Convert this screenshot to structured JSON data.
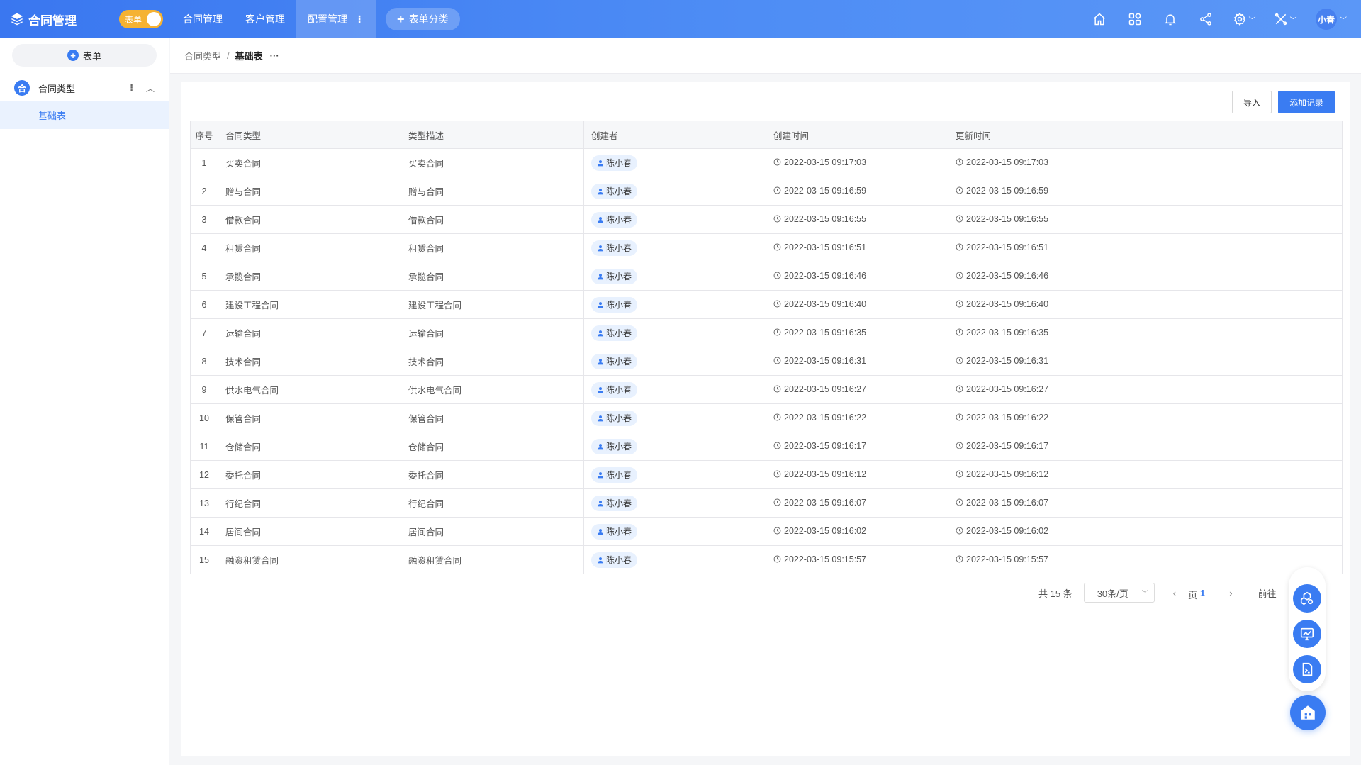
{
  "header": {
    "app_title": "合同管理",
    "toggle_label": "表单",
    "nav": [
      {
        "label": "合同管理"
      },
      {
        "label": "客户管理"
      },
      {
        "label": "配置管理"
      }
    ],
    "nav_more": "⋮",
    "add_category_label": "表单分类",
    "user_name": "小春"
  },
  "sidebar": {
    "new_form_label": "表单",
    "group_badge": "合",
    "group_label": "合同类型",
    "active_item": "基础表"
  },
  "breadcrumb": {
    "parent": "合同类型",
    "separator": "/",
    "current": "基础表",
    "more": "···"
  },
  "toolbar": {
    "import_label": "导入",
    "add_record_label": "添加记录"
  },
  "table": {
    "columns": [
      "序号",
      "合同类型",
      "类型描述",
      "创建者",
      "创建时间",
      "更新时间"
    ],
    "rows": [
      {
        "idx": "1",
        "type": "买卖合同",
        "desc": "买卖合同",
        "creator": "陈小春",
        "created": "2022-03-15 09:17:03",
        "updated": "2022-03-15 09:17:03"
      },
      {
        "idx": "2",
        "type": "赠与合同",
        "desc": "赠与合同",
        "creator": "陈小春",
        "created": "2022-03-15 09:16:59",
        "updated": "2022-03-15 09:16:59"
      },
      {
        "idx": "3",
        "type": "借款合同",
        "desc": "借款合同",
        "creator": "陈小春",
        "created": "2022-03-15 09:16:55",
        "updated": "2022-03-15 09:16:55"
      },
      {
        "idx": "4",
        "type": "租赁合同",
        "desc": "租赁合同",
        "creator": "陈小春",
        "created": "2022-03-15 09:16:51",
        "updated": "2022-03-15 09:16:51"
      },
      {
        "idx": "5",
        "type": "承揽合同",
        "desc": "承揽合同",
        "creator": "陈小春",
        "created": "2022-03-15 09:16:46",
        "updated": "2022-03-15 09:16:46"
      },
      {
        "idx": "6",
        "type": "建设工程合同",
        "desc": "建设工程合同",
        "creator": "陈小春",
        "created": "2022-03-15 09:16:40",
        "updated": "2022-03-15 09:16:40"
      },
      {
        "idx": "7",
        "type": "运输合同",
        "desc": "运输合同",
        "creator": "陈小春",
        "created": "2022-03-15 09:16:35",
        "updated": "2022-03-15 09:16:35"
      },
      {
        "idx": "8",
        "type": "技术合同",
        "desc": "技术合同",
        "creator": "陈小春",
        "created": "2022-03-15 09:16:31",
        "updated": "2022-03-15 09:16:31"
      },
      {
        "idx": "9",
        "type": "供水电气合同",
        "desc": "供水电气合同",
        "creator": "陈小春",
        "created": "2022-03-15 09:16:27",
        "updated": "2022-03-15 09:16:27"
      },
      {
        "idx": "10",
        "type": "保管合同",
        "desc": "保管合同",
        "creator": "陈小春",
        "created": "2022-03-15 09:16:22",
        "updated": "2022-03-15 09:16:22"
      },
      {
        "idx": "11",
        "type": "仓储合同",
        "desc": "仓储合同",
        "creator": "陈小春",
        "created": "2022-03-15 09:16:17",
        "updated": "2022-03-15 09:16:17"
      },
      {
        "idx": "12",
        "type": "委托合同",
        "desc": "委托合同",
        "creator": "陈小春",
        "created": "2022-03-15 09:16:12",
        "updated": "2022-03-15 09:16:12"
      },
      {
        "idx": "13",
        "type": "行纪合同",
        "desc": "行纪合同",
        "creator": "陈小春",
        "created": "2022-03-15 09:16:07",
        "updated": "2022-03-15 09:16:07"
      },
      {
        "idx": "14",
        "type": "居间合同",
        "desc": "居间合同",
        "creator": "陈小春",
        "created": "2022-03-15 09:16:02",
        "updated": "2022-03-15 09:16:02"
      },
      {
        "idx": "15",
        "type": "融资租赁合同",
        "desc": "融资租赁合同",
        "creator": "陈小春",
        "created": "2022-03-15 09:15:57",
        "updated": "2022-03-15 09:15:57"
      }
    ]
  },
  "pagination": {
    "total": "共 15 条",
    "page_size": "30条/页",
    "current_page": "1",
    "goto_label": "前往",
    "page_suffix": "页"
  },
  "colors": {
    "primary": "#3a7cf2",
    "toggle": "#f5b232",
    "chip_bg": "#e8f1fe"
  },
  "icons": {
    "header": [
      "home-icon",
      "apps-icon",
      "bell-icon",
      "share-icon",
      "settings-icon",
      "tools-icon"
    ],
    "floating": [
      "cubes-icon",
      "monitor-chart-icon",
      "terminal-icon",
      "home-float-icon"
    ]
  }
}
